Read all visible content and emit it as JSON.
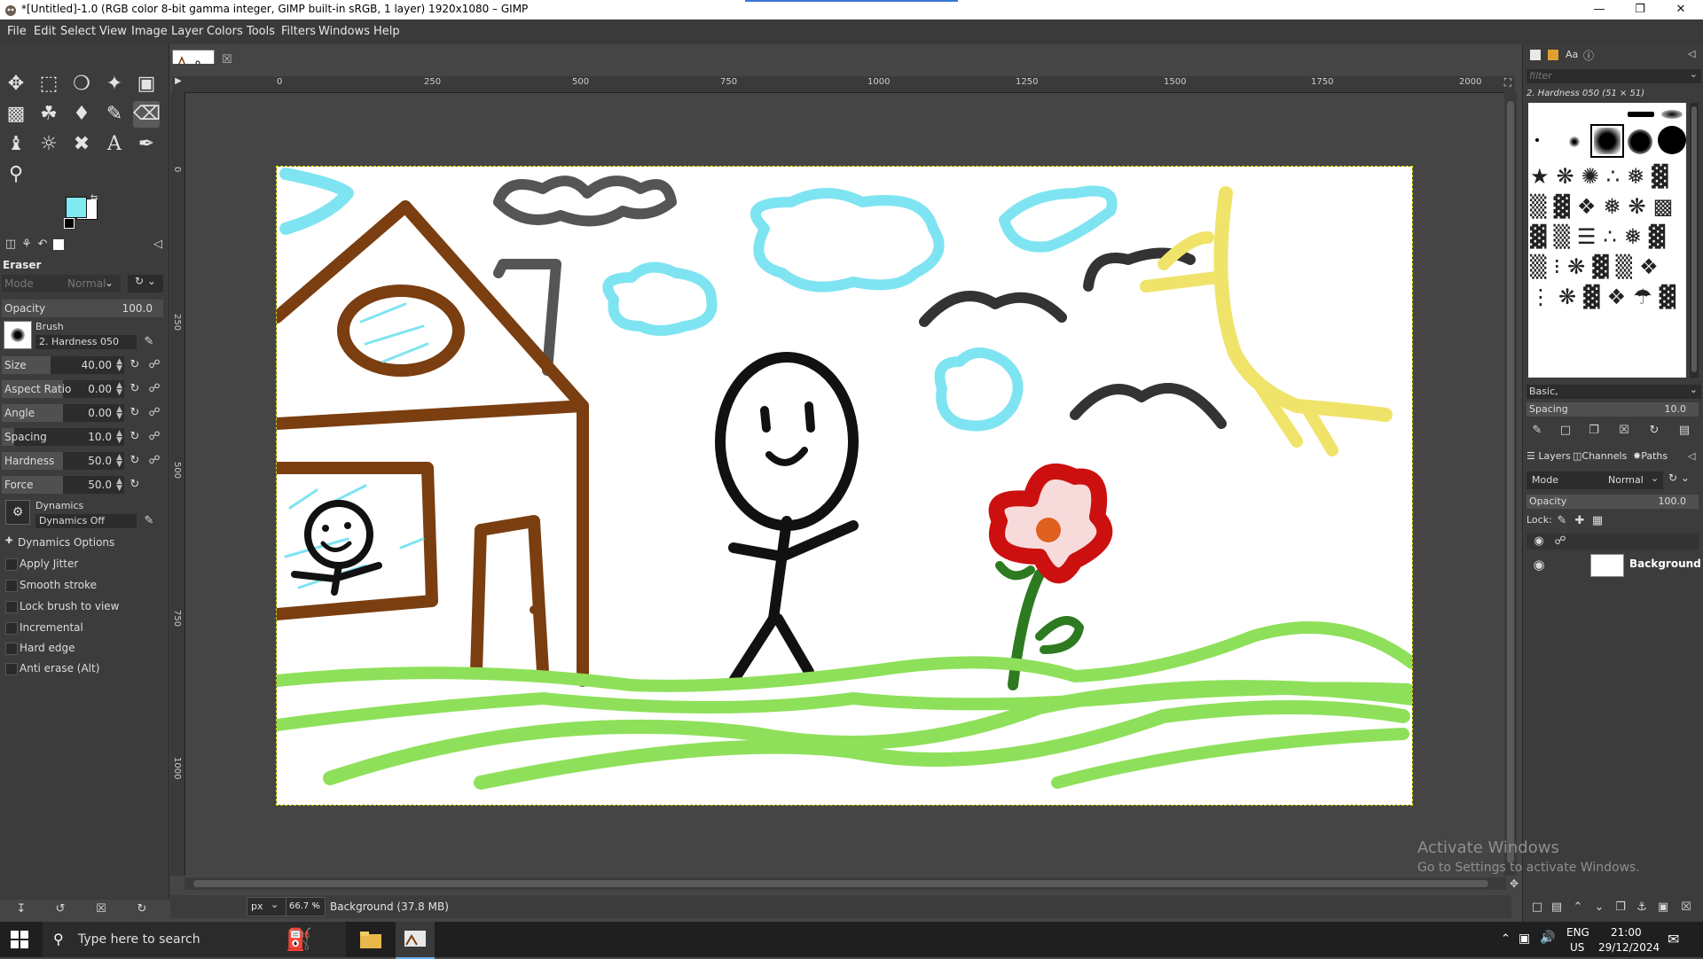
{
  "window": {
    "title": "*[Untitled]-1.0 (RGB color 8-bit gamma integer, GIMP built-in sRGB, 1 layer) 1920x1080 – GIMP",
    "min_icon": "minimize-icon",
    "max_icon": "maximize-icon",
    "close_icon": "close-icon"
  },
  "menu": [
    "File",
    "Edit",
    "Select",
    "View",
    "Image",
    "Layer",
    "Colors",
    "Tools",
    "Filters",
    "Windows",
    "Help"
  ],
  "colors": {
    "foreground": "#7feaf0",
    "background": "#ffffff",
    "accent": "#3a78d8",
    "sky": "#7fe4f2",
    "house": "#7a3e10",
    "grass": "#8ee05a",
    "sun": "#f0e36a",
    "flower": "#cc1010"
  },
  "tool_options": {
    "tool_name": "Eraser",
    "mode_label": "Mode",
    "mode_value": "Normal",
    "opacity_label": "Opacity",
    "opacity_value": "100.0",
    "brush_label": "Brush",
    "brush_value": "2. Hardness 050",
    "size_label": "Size",
    "size_value": "40.00",
    "aspect_label": "Aspect Ratio",
    "aspect_value": "0.00",
    "angle_label": "Angle",
    "angle_value": "0.00",
    "spacing_label": "Spacing",
    "spacing_value": "10.0",
    "hardness_label": "Hardness",
    "hardness_value": "50.0",
    "force_label": "Force",
    "force_value": "50.0",
    "dynamics_label": "Dynamics",
    "dynamics_value": "Dynamics Off",
    "dynamics_options": "Dynamics Options",
    "options": [
      "Apply Jitter",
      "Smooth stroke",
      "Lock brush to view",
      "Incremental",
      "Hard edge",
      "Anti erase  (Alt)"
    ]
  },
  "rulers": {
    "h_ticks": [
      "0",
      "250",
      "500",
      "750",
      "1000",
      "1250",
      "1500",
      "1750",
      "2000"
    ],
    "v_ticks": [
      "0",
      "250",
      "500",
      "750",
      "1000"
    ]
  },
  "status": {
    "unit": "px",
    "zoom": "66.7 %",
    "info": "Background (37.8 MB)"
  },
  "brushes_panel": {
    "filter_placeholder": "filter",
    "selected_brush": "2. Hardness 050 (51 × 51)",
    "preset": "Basic,",
    "spacing_label": "Spacing",
    "spacing_value": "10.0"
  },
  "layers_panel": {
    "tabs": [
      "Layers",
      "Channels",
      "Paths"
    ],
    "mode_label": "Mode",
    "mode_value": "Normal",
    "opacity_label": "Opacity",
    "opacity_value": "100.0",
    "lock_label": "Lock:",
    "layer_name": "Background"
  },
  "watermark": {
    "line1": "Activate Windows",
    "line2": "Go to Settings to activate Windows."
  },
  "taskbar": {
    "search_placeholder": "Type here to search",
    "lang1": "ENG",
    "lang2": "US",
    "time": "21:00",
    "date": "29/12/2024"
  }
}
